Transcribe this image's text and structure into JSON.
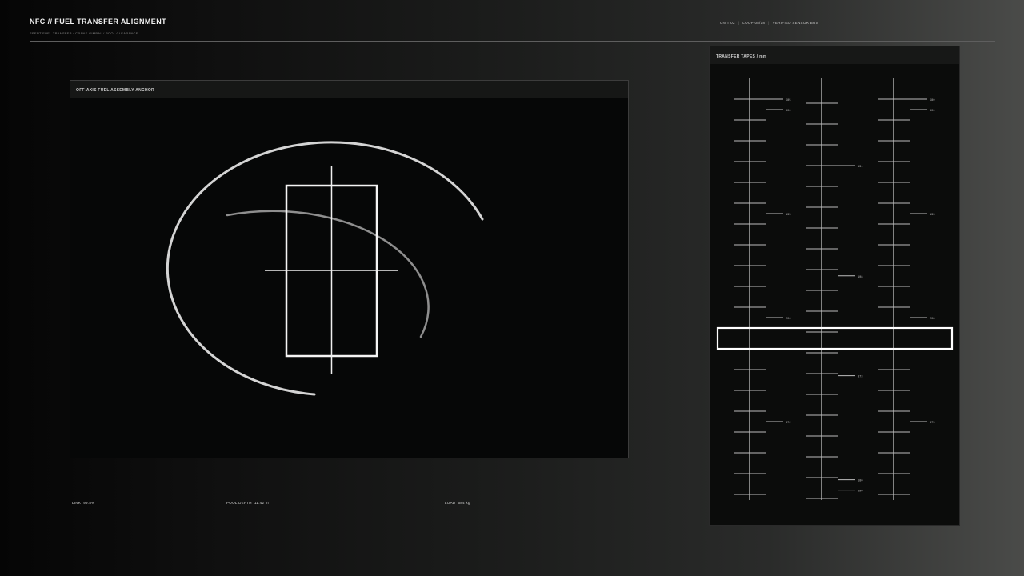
{
  "header": {
    "title": "NFC // FUEL TRANSFER ALIGNMENT",
    "subtitle": "SPENT-FUEL TRANSFER / CRANE GIMBAL / POOL CLEARANCE",
    "status": [
      "UNIT 02",
      "LOOP 08/18",
      "VERIFIED SENSOR BUS"
    ]
  },
  "anchor_panel": {
    "title": "OFF-AXIS FUEL ASSEMBLY ANCHOR"
  },
  "stats": {
    "link_label": "LINK",
    "link_value": "99.8%",
    "depth_label": "POOL DEPTH",
    "depth_value": "11.42 m",
    "load_label": "LOAD",
    "load_value": "684 kg"
  },
  "tapes_panel": {
    "title": "TRANSFER TAPES / mm",
    "tapes": [
      {
        "name": "tape-left",
        "labels": [
          {
            "text": "585",
            "row": 0
          },
          {
            "text": "800",
            "row": 0.5
          },
          {
            "text": "135",
            "row": 5.5
          },
          {
            "text": "206",
            "row": 10.5
          },
          {
            "text": "372",
            "row": 15.5
          }
        ]
      },
      {
        "name": "tape-center",
        "labels": [
          {
            "text": "131",
            "row": 3
          },
          {
            "text": "108",
            "row": 8.3
          },
          {
            "text": "373",
            "row": 13.1
          },
          {
            "text": "180",
            "row": 18.1
          },
          {
            "text": "890",
            "row": 18.6
          }
        ]
      },
      {
        "name": "tape-right",
        "labels": [
          {
            "text": "580",
            "row": 0
          },
          {
            "text": "800",
            "row": 0.5
          },
          {
            "text": "133",
            "row": 5.5
          },
          {
            "text": "208",
            "row": 10.5
          },
          {
            "text": "375",
            "row": 15.5
          }
        ]
      }
    ]
  },
  "colors": {
    "accent": "#ffffff",
    "panel_bg": "#060707",
    "outer_ring": "#d6d6d6",
    "inner_ring": "#8c8c8c"
  }
}
